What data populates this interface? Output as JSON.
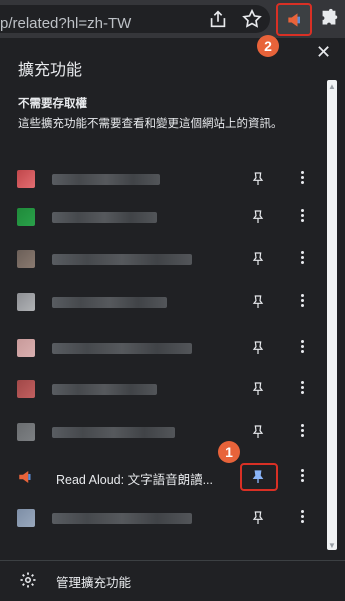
{
  "browser": {
    "url_text": "p/related?hl=zh-TW",
    "annotation_2": "2"
  },
  "panel": {
    "title": "擴充功能",
    "close_glyph": "✕",
    "section_heading": "不需要存取權",
    "section_description": "這些擴充功能不需要查看和變更這個網站上的資訊。",
    "annotation_1": "1",
    "extensions": [
      {
        "name": "",
        "icon_colors": [
          "#c0474b",
          "#e36e72"
        ]
      },
      {
        "name": "",
        "icon_colors": [
          "#1f8a3a",
          "#2aa14a"
        ]
      },
      {
        "name": "",
        "icon_colors": [
          "#6b5f58",
          "#8a7a70"
        ]
      },
      {
        "name": "",
        "icon_colors": [
          "#8d8f93",
          "#b1b3b6"
        ]
      },
      {
        "name": "",
        "icon_colors": [
          "#c89a9a",
          "#d9b0b0"
        ]
      },
      {
        "name": "",
        "icon_colors": [
          "#a04848",
          "#c26060"
        ]
      },
      {
        "name": "",
        "icon_colors": [
          "#6a6d70",
          "#7d8083"
        ]
      },
      {
        "name": "Read Aloud: 文字語音朗讀...",
        "icon_colors": [
          "#e8633a",
          "#5b8dd6"
        ]
      },
      {
        "name": "",
        "icon_colors": [
          "#7d8ea6",
          "#9aa9bd"
        ]
      }
    ],
    "footer_label": "管理擴充功能"
  }
}
